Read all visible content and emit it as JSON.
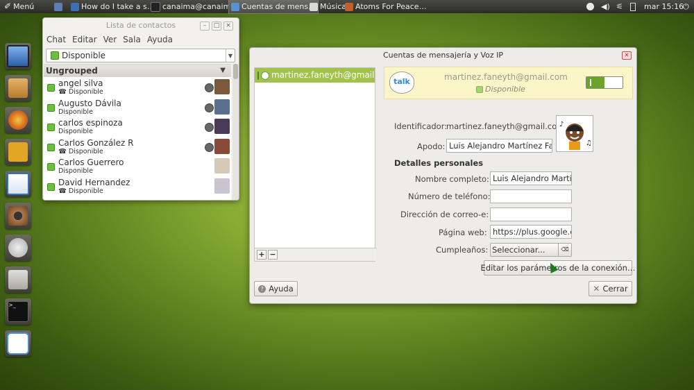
{
  "panel": {
    "menu_label": "Menú",
    "tasks": [
      {
        "label": "How do I take a s…",
        "color": "#3b6fb6",
        "active": false
      },
      {
        "label": "canaima@canaim…",
        "color": "#222222",
        "active": false
      },
      {
        "label": "Cuentas de mens…",
        "color": "#5a8fd0",
        "active": true
      },
      {
        "label": "Música",
        "color": "#d9d9d9",
        "active": false
      },
      {
        "label": "Atoms For Peace…",
        "color": "#c0602c",
        "active": false
      }
    ],
    "clock": "mar 15:16"
  },
  "dock": {
    "items": [
      {
        "name": "computer-icon",
        "color": "#4a7cc9"
      },
      {
        "name": "home-folder-icon",
        "color": "#c98b3c"
      },
      {
        "name": "firefox-icon",
        "color": "#e17b1e"
      },
      {
        "name": "twitter-bird-icon",
        "color": "#d79b1c"
      },
      {
        "name": "document-writer-icon",
        "color": "#2f74c0"
      },
      {
        "name": "speaker-icon",
        "color": "#8a5a36"
      },
      {
        "name": "recycle-icon",
        "color": "#c8c8c0"
      },
      {
        "name": "file-cabinet-icon",
        "color": "#bdbdb6"
      },
      {
        "name": "terminal-icon",
        "color": "#1a1a1a"
      },
      {
        "name": "chat-bubble-icon",
        "color": "#4d8fd3"
      }
    ]
  },
  "contacts": {
    "title": "Lista de contactos",
    "menu": [
      "Chat",
      "Editar",
      "Ver",
      "Sala",
      "Ayuda"
    ],
    "status": "Disponible",
    "group": "Ungrouped",
    "list": [
      {
        "name": "angel silva",
        "status": "Disponible",
        "phone": true,
        "cam": true,
        "avatar": "#7a5a3a"
      },
      {
        "name": "Augusto Dávila",
        "status": "Disponible",
        "phone": false,
        "cam": true,
        "avatar": "#5a6f8f"
      },
      {
        "name": "carlos espinoza",
        "status": "Disponible",
        "phone": false,
        "cam": true,
        "avatar": "#4a3a5a"
      },
      {
        "name": "Carlos González R",
        "status": "Disponible",
        "phone": true,
        "cam": true,
        "avatar": "#8a4a3a"
      },
      {
        "name": "Carlos Guerrero",
        "status": "Disponible",
        "phone": false,
        "cam": false,
        "avatar": "#d6c9b8"
      },
      {
        "name": "David Hernandez",
        "status": "Disponible",
        "phone": true,
        "cam": false,
        "avatar": "#c9c4cf"
      }
    ]
  },
  "dialog": {
    "title": "Cuentas de mensajería y Voz IP",
    "account": "martinez.faneyth@gmail.com",
    "banner_email": "martinez.faneyth@gmail.com",
    "banner_status": "Disponible",
    "talk_label": "talk",
    "identifier_label": "Identificador:",
    "identifier_value": "martinez.faneyth@gmail.com",
    "alias_label": "Apodo:",
    "alias_value": "Luis Alejandro Martínez Far",
    "section": "Detalles personales",
    "full_name_label": "Nombre completo:",
    "full_name_value": "Luis Alejandro Martín",
    "phone_label": "Número de teléfono:",
    "phone_value": "",
    "email_label": "Dirección de correo-e:",
    "email_value": "",
    "web_label": "Página web:",
    "web_value": "https://plus.google.c",
    "birthday_label": "Cumpleaños:",
    "birthday_value": "Seleccionar...",
    "edit_conn": "Editar los parámetros de la conexión…",
    "help": "Ayuda",
    "close": "Cerrar"
  }
}
